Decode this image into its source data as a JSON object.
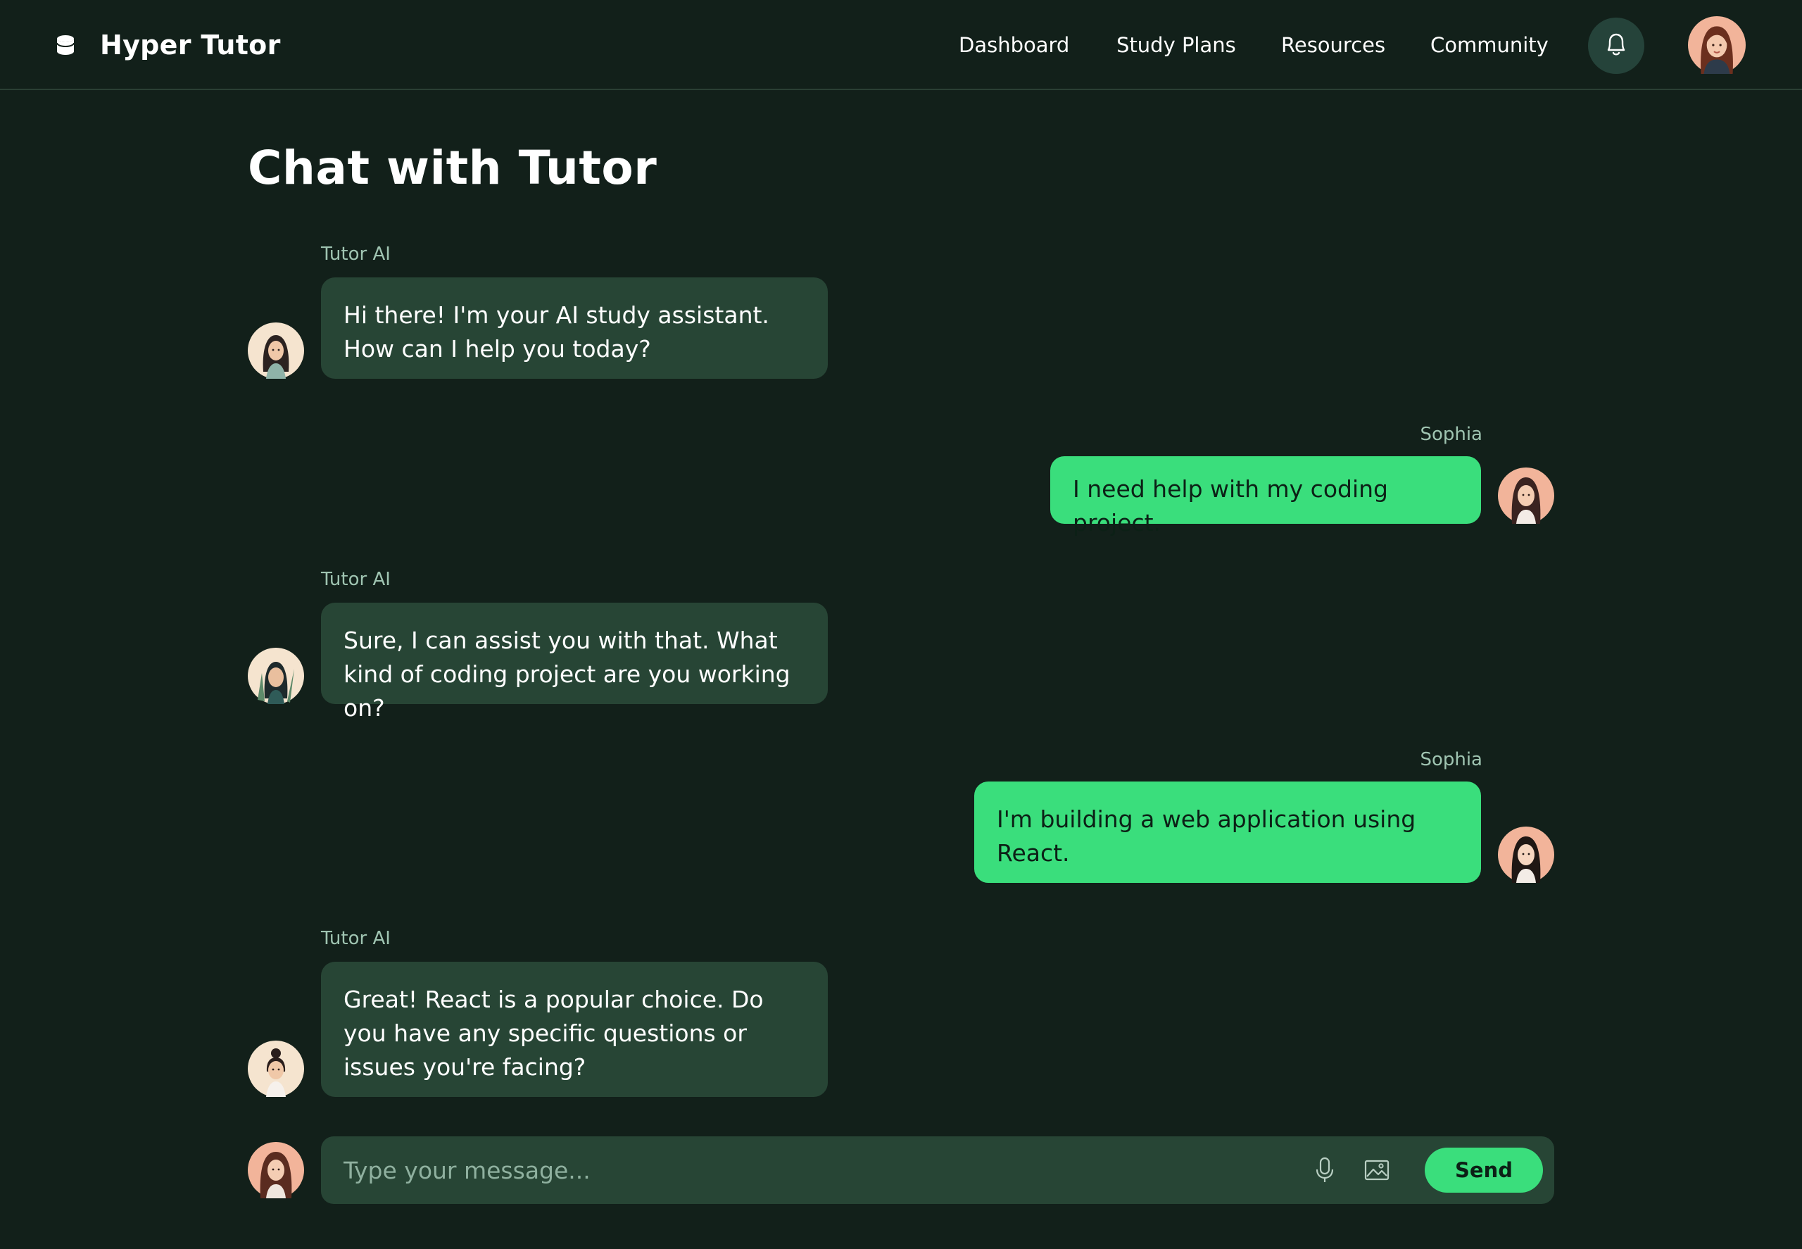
{
  "app": {
    "name": "Hyper Tutor",
    "logo_icon": "database-icon"
  },
  "nav": {
    "links": [
      "Dashboard",
      "Study Plans",
      "Resources",
      "Community"
    ],
    "notifications_icon": "bell-icon"
  },
  "page": {
    "title": "Chat with Tutor"
  },
  "messages": [
    {
      "role": "ai",
      "sender": "Tutor AI",
      "text": "Hi there! I'm your AI study assistant. How can I help you today?"
    },
    {
      "role": "user",
      "sender": "Sophia",
      "text": "I need help with my coding project."
    },
    {
      "role": "ai",
      "sender": "Tutor AI",
      "text": "Sure, I can assist you with that. What kind of coding project are you working on?"
    },
    {
      "role": "user",
      "sender": "Sophia",
      "text": "I'm building a web application using React."
    },
    {
      "role": "ai",
      "sender": "Tutor AI",
      "text": "Great! React is a popular choice. Do you have any specific questions or issues you're facing?"
    }
  ],
  "composer": {
    "placeholder": "Type your message...",
    "value": "",
    "mic_icon": "microphone-icon",
    "image_icon": "image-icon",
    "send_label": "Send"
  },
  "colors": {
    "background": "#12201a",
    "ai_bubble": "#274535",
    "user_bubble": "#3ade7c",
    "accent": "#3ade7c",
    "muted_text": "#9fc4b1"
  }
}
